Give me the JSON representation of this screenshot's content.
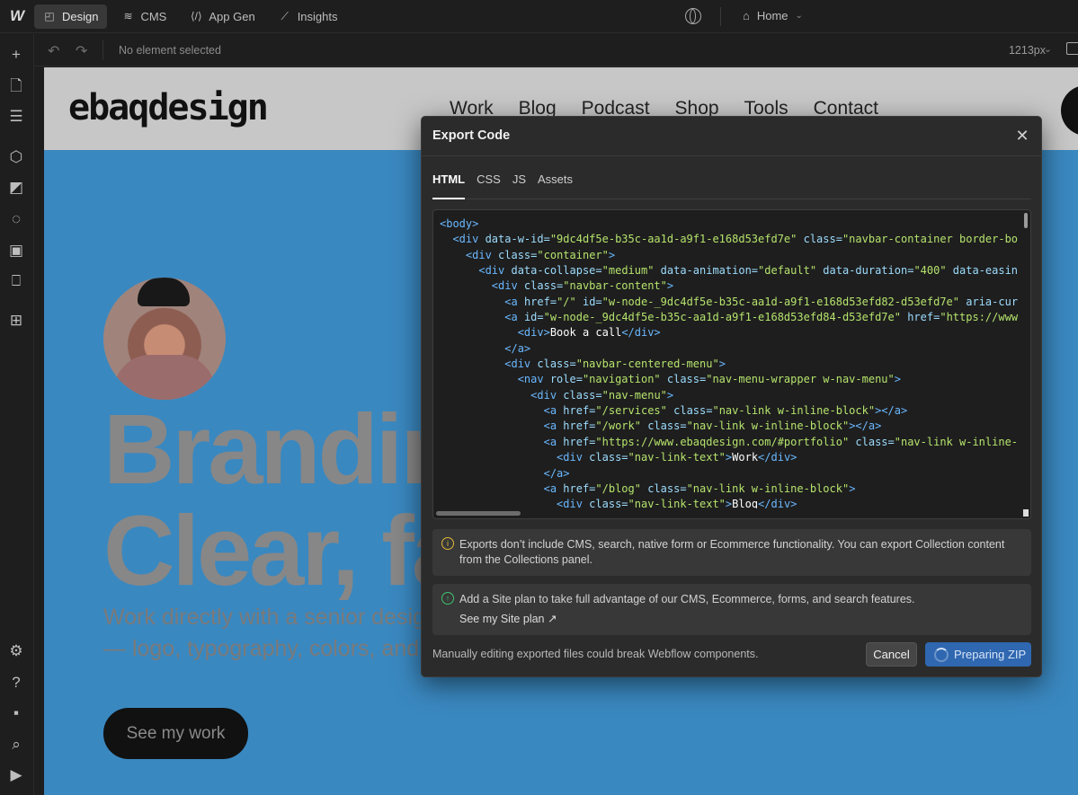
{
  "topbar": {
    "logo": "W",
    "tabs": [
      {
        "label": "Design",
        "icon": "cursor-square-icon",
        "active": true
      },
      {
        "label": "CMS",
        "icon": "database-icon",
        "active": false
      },
      {
        "label": "App Gen",
        "icon": "code-slash-icon",
        "active": false
      },
      {
        "label": "Insights",
        "icon": "line-chart-icon",
        "active": false
      }
    ],
    "page_select": {
      "label": "Home",
      "icon": "home-icon"
    }
  },
  "subbar": {
    "selection_status": "No element selected",
    "width_readout": "1213px"
  },
  "leftrail": {
    "icons": [
      "add-icon",
      "pages-icon",
      "navigator-icon",
      "components-icon",
      "styles-icon",
      "variables-icon",
      "assets-icon",
      "cms-book-icon",
      "apps-icon",
      "settings-icon",
      "help-icon",
      "audit-icon",
      "search-icon",
      "video-icon"
    ]
  },
  "canvas": {
    "site_logo": {
      "pre": "ebaq",
      "mid": "design"
    },
    "nav_links": [
      "Work",
      "Blog",
      "Podcast",
      "Shop",
      "Tools",
      "Contact"
    ],
    "hero_line1": "Brandin",
    "hero_line2": "Clear, fa",
    "hero_sub1": "Work directly with a senior desig",
    "hero_sub2": "— logo, typography, colors, and",
    "cta": "See my work"
  },
  "modal": {
    "title": "Export Code",
    "close_icon": "close-icon",
    "tabs": [
      {
        "label": "HTML",
        "active": true
      },
      {
        "label": "CSS",
        "active": false
      },
      {
        "label": "JS",
        "active": false
      },
      {
        "label": "Assets",
        "active": false
      }
    ],
    "code_lines": [
      {
        "indent": 0,
        "tokens": [
          [
            "tag",
            "<body>"
          ]
        ]
      },
      {
        "indent": 1,
        "tokens": [
          [
            "tag",
            "<div "
          ],
          [
            "attr",
            "data-w-id="
          ],
          [
            "val",
            "\"9dc4df5e-b35c-aa1d-a9f1-e168d53efd7e\""
          ],
          [
            "attr",
            " class="
          ],
          [
            "val",
            "\"navbar-container border-bo"
          ]
        ]
      },
      {
        "indent": 2,
        "tokens": [
          [
            "tag",
            "<div "
          ],
          [
            "attr",
            "class="
          ],
          [
            "val",
            "\"container\""
          ],
          [
            "tag",
            ">"
          ]
        ]
      },
      {
        "indent": 3,
        "tokens": [
          [
            "tag",
            "<div "
          ],
          [
            "attr",
            "data-collapse="
          ],
          [
            "val",
            "\"medium\""
          ],
          [
            "attr",
            " data-animation="
          ],
          [
            "val",
            "\"default\""
          ],
          [
            "attr",
            " data-duration="
          ],
          [
            "val",
            "\"400\""
          ],
          [
            "attr",
            " data-easin"
          ]
        ]
      },
      {
        "indent": 4,
        "tokens": [
          [
            "tag",
            "<div "
          ],
          [
            "attr",
            "class="
          ],
          [
            "val",
            "\"navbar-content\""
          ],
          [
            "tag",
            ">"
          ]
        ]
      },
      {
        "indent": 5,
        "tokens": [
          [
            "tag",
            "<a "
          ],
          [
            "attr",
            "href="
          ],
          [
            "val",
            "\"/\""
          ],
          [
            "attr",
            " id="
          ],
          [
            "val",
            "\"w-node-_9dc4df5e-b35c-aa1d-a9f1-e168d53efd82-d53efd7e\""
          ],
          [
            "attr",
            " aria-cur"
          ]
        ]
      },
      {
        "indent": 5,
        "tokens": [
          [
            "tag",
            "<a "
          ],
          [
            "attr",
            "id="
          ],
          [
            "val",
            "\"w-node-_9dc4df5e-b35c-aa1d-a9f1-e168d53efd84-d53efd7e\""
          ],
          [
            "attr",
            " href="
          ],
          [
            "val",
            "\"https://www"
          ]
        ]
      },
      {
        "indent": 6,
        "tokens": [
          [
            "tag",
            "<div>"
          ],
          [
            "text",
            "Book a call"
          ],
          [
            "tag",
            "</div>"
          ]
        ]
      },
      {
        "indent": 5,
        "tokens": [
          [
            "tag",
            "</a>"
          ]
        ]
      },
      {
        "indent": 5,
        "tokens": [
          [
            "tag",
            "<div "
          ],
          [
            "attr",
            "class="
          ],
          [
            "val",
            "\"navbar-centered-menu\""
          ],
          [
            "tag",
            ">"
          ]
        ]
      },
      {
        "indent": 6,
        "tokens": [
          [
            "tag",
            "<nav "
          ],
          [
            "attr",
            "role="
          ],
          [
            "val",
            "\"navigation\""
          ],
          [
            "attr",
            " class="
          ],
          [
            "val",
            "\"nav-menu-wrapper w-nav-menu\""
          ],
          [
            "tag",
            ">"
          ]
        ]
      },
      {
        "indent": 7,
        "tokens": [
          [
            "tag",
            "<div "
          ],
          [
            "attr",
            "class="
          ],
          [
            "val",
            "\"nav-menu\""
          ],
          [
            "tag",
            ">"
          ]
        ]
      },
      {
        "indent": 8,
        "tokens": [
          [
            "tag",
            "<a "
          ],
          [
            "attr",
            "href="
          ],
          [
            "val",
            "\"/services\""
          ],
          [
            "attr",
            " class="
          ],
          [
            "val",
            "\"nav-link w-inline-block\""
          ],
          [
            "tag",
            "></a>"
          ]
        ]
      },
      {
        "indent": 8,
        "tokens": [
          [
            "tag",
            "<a "
          ],
          [
            "attr",
            "href="
          ],
          [
            "val",
            "\"/work\""
          ],
          [
            "attr",
            " class="
          ],
          [
            "val",
            "\"nav-link w-inline-block\""
          ],
          [
            "tag",
            "></a>"
          ]
        ]
      },
      {
        "indent": 8,
        "tokens": [
          [
            "tag",
            "<a "
          ],
          [
            "attr",
            "href="
          ],
          [
            "val",
            "\"https://www.ebaqdesign.com/#portfolio\""
          ],
          [
            "attr",
            " class="
          ],
          [
            "val",
            "\"nav-link w-inline-"
          ]
        ]
      },
      {
        "indent": 9,
        "tokens": [
          [
            "tag",
            "<div "
          ],
          [
            "attr",
            "class="
          ],
          [
            "val",
            "\"nav-link-text\""
          ],
          [
            "tag",
            ">"
          ],
          [
            "text",
            "Work"
          ],
          [
            "tag",
            "</div>"
          ]
        ]
      },
      {
        "indent": 8,
        "tokens": [
          [
            "tag",
            "</a>"
          ]
        ]
      },
      {
        "indent": 8,
        "tokens": [
          [
            "tag",
            "<a "
          ],
          [
            "attr",
            "href="
          ],
          [
            "val",
            "\"/blog\""
          ],
          [
            "attr",
            " class="
          ],
          [
            "val",
            "\"nav-link w-inline-block\""
          ],
          [
            "tag",
            ">"
          ]
        ]
      },
      {
        "indent": 9,
        "tokens": [
          [
            "tag",
            "<div "
          ],
          [
            "attr",
            "class="
          ],
          [
            "val",
            "\"nav-link-text\""
          ],
          [
            "tag",
            ">"
          ],
          [
            "text",
            "Blog"
          ],
          [
            "tag",
            "</div>"
          ]
        ]
      }
    ],
    "notice_export": "Exports don’t include CMS, search, native form or Ecommerce functionality. You can export Collection content from the Collections panel.",
    "notice_plan": "Add a Site plan to take full advantage of our CMS, Ecommerce, forms, and search features.",
    "notice_plan_link": "See my Site plan ↗",
    "footer_note": "Manually editing exported files could break Webflow components.",
    "cancel_label": "Cancel",
    "zip_label": "Preparing ZIP"
  },
  "colors": {
    "canvas_bg": "#3a88c0",
    "primary_button": "#2f67b0",
    "code_tag": "#6ab8ff",
    "code_value": "#b5e36c"
  }
}
